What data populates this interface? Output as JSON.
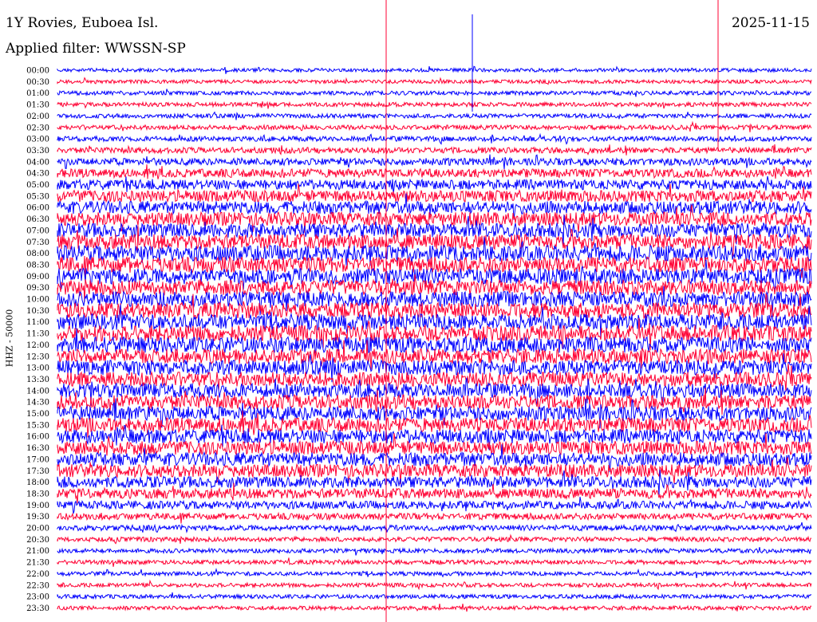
{
  "header": {
    "station": "1Y Rovies, Euboea Isl.",
    "date": "2025-11-15",
    "filter": "Applied filter: WWSSN-SP"
  },
  "chart_data": {
    "type": "line",
    "title": "1Y Rovies, Euboea Isl.",
    "subtitle": "Applied filter: WWSSN-SP",
    "ylabel": "HHZ - 50000",
    "row_labels": [
      "00:00",
      "00:30",
      "01:00",
      "01:30",
      "02:00",
      "02:30",
      "03:00",
      "03:30",
      "04:00",
      "04:30",
      "05:00",
      "05:30",
      "06:00",
      "06:30",
      "07:00",
      "07:30",
      "08:00",
      "08:30",
      "09:00",
      "09:30",
      "10:00",
      "10:30",
      "11:00",
      "11:30",
      "12:00",
      "12:30",
      "13:00",
      "13:30",
      "14:00",
      "14:30",
      "15:00",
      "15:30",
      "16:00",
      "16:30",
      "17:00",
      "17:30",
      "18:00",
      "18:30",
      "19:00",
      "19:30",
      "20:00",
      "20:30",
      "21:00",
      "21:30",
      "22:00",
      "22:30",
      "23:00",
      "23:30"
    ],
    "trace_colors": [
      "#0000ff",
      "#ff0033"
    ],
    "noise_level": [
      0.25,
      0.25,
      0.28,
      0.3,
      0.3,
      0.32,
      0.35,
      0.4,
      0.5,
      0.6,
      0.7,
      0.8,
      0.9,
      0.95,
      1.0,
      1.05,
      1.1,
      1.1,
      1.1,
      1.05,
      1.05,
      1.1,
      1.1,
      1.1,
      1.1,
      1.05,
      1.05,
      1.0,
      1.0,
      1.0,
      1.0,
      1.0,
      1.0,
      0.95,
      0.95,
      0.9,
      0.8,
      0.7,
      0.55,
      0.45,
      0.38,
      0.32,
      0.3,
      0.3,
      0.28,
      0.28,
      0.28,
      0.28
    ]
  }
}
